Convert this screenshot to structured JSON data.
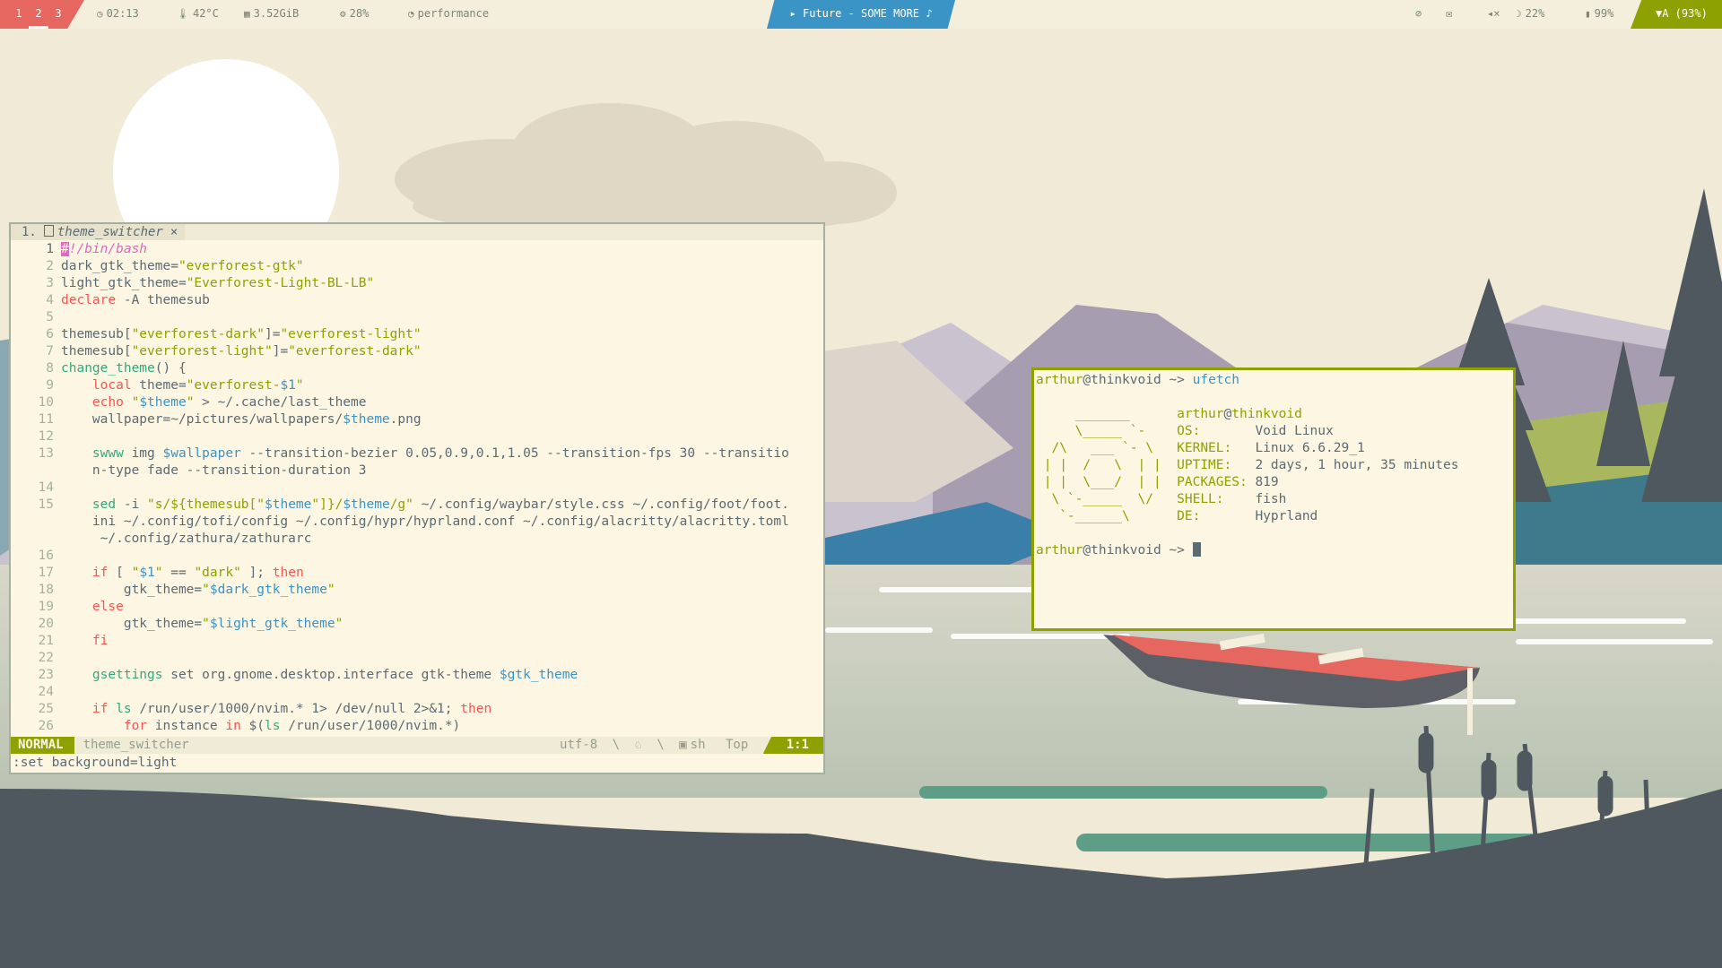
{
  "colors": {
    "workspace_bg": "#e5675f",
    "media_bg": "#3a94c5",
    "network_bg": "#8da101",
    "terminal_border": "#8da101",
    "nvim_mode_bg": "#8da101"
  },
  "topbar": {
    "workspaces": [
      "1",
      "2",
      "3"
    ],
    "active_workspace": "2",
    "time": "02:13",
    "temperature": "42°C",
    "memory": "3.52GiB",
    "cpu": "28%",
    "power_profile": "performance",
    "media": "▸ Future - SOME MORE ♪",
    "brightness": "22%",
    "battery": "99%",
    "network": "A (93%)",
    "icons": {
      "clock": "clock-icon",
      "temperature": "thermometer-icon",
      "memory": "memory-icon",
      "cpu": "cpu-icon",
      "power": "power-profile-icon",
      "idle": "idle-inhibitor-icon",
      "notifications": "notification-icon",
      "volume": "mute-icon",
      "brightness": "brightness-icon",
      "battery": "battery-icon",
      "wifi": "wifi-icon"
    }
  },
  "nvim": {
    "tab_index": "1.",
    "tab_name": "theme_switcher",
    "tab_close": "×",
    "lines": [
      {
        "n": "1",
        "text": "#!/bin/bash"
      },
      {
        "n": "2",
        "text": "dark_gtk_theme=\"everforest-gtk\""
      },
      {
        "n": "3",
        "text": "light_gtk_theme=\"Everforest-Light-BL-LB\""
      },
      {
        "n": "4",
        "text": "declare -A themesub"
      },
      {
        "n": "5",
        "text": ""
      },
      {
        "n": "6",
        "text": "themesub[\"everforest-dark\"]=\"everforest-light\""
      },
      {
        "n": "7",
        "text": "themesub[\"everforest-light\"]=\"everforest-dark\""
      },
      {
        "n": "8",
        "text": "change_theme() {"
      },
      {
        "n": "9",
        "text": "    local theme=\"everforest-$1\""
      },
      {
        "n": "10",
        "text": "    echo \"$theme\" > ~/.cache/last_theme"
      },
      {
        "n": "11",
        "text": "    wallpaper=~/pictures/wallpapers/$theme.png"
      },
      {
        "n": "12",
        "text": ""
      },
      {
        "n": "13",
        "text": "    swww img $wallpaper --transition-bezier 0.05,0.9,0.1,1.05 --transition-fps 30 --transitio"
      },
      {
        "n": "",
        "text": "    n-type fade --transition-duration 3"
      },
      {
        "n": "14",
        "text": ""
      },
      {
        "n": "15",
        "text": "    sed -i \"s/${themesub[\"$theme\"]}/$theme/g\" ~/.config/waybar/style.css ~/.config/foot/foot."
      },
      {
        "n": "",
        "text": "    ini ~/.config/tofi/config ~/.config/hypr/hyprland.conf ~/.config/alacritty/alacritty.toml"
      },
      {
        "n": "",
        "text": "     ~/.config/zathura/zathurarc"
      },
      {
        "n": "16",
        "text": ""
      },
      {
        "n": "17",
        "text": "    if [ \"$1\" == \"dark\" ]; then"
      },
      {
        "n": "18",
        "text": "        gtk_theme=\"$dark_gtk_theme\""
      },
      {
        "n": "19",
        "text": "    else"
      },
      {
        "n": "20",
        "text": "        gtk_theme=\"$light_gtk_theme\""
      },
      {
        "n": "21",
        "text": "    fi"
      },
      {
        "n": "22",
        "text": ""
      },
      {
        "n": "23",
        "text": "    gsettings set org.gnome.desktop.interface gtk-theme $gtk_theme"
      },
      {
        "n": "24",
        "text": ""
      },
      {
        "n": "25",
        "text": "    if ls /run/user/1000/nvim.* 1> /dev/null 2>&1; then"
      },
      {
        "n": "26",
        "text": "        for instance in $(ls /run/user/1000/nvim.*)"
      }
    ],
    "status": {
      "mode": "NORMAL",
      "file": "theme_switcher",
      "encoding": "utf-8",
      "os_icon": "linux-icon",
      "filetype": "sh",
      "position": "Top",
      "cursor": "1:1"
    },
    "command_line": ":set background=light"
  },
  "terminal": {
    "prompt_user": "arthur",
    "prompt_host": "thinkvoid",
    "prompt_suffix": " ~> ",
    "command": "ufetch",
    "ascii": [
      "     _______",
      "     \\_____ `-",
      "  /\\   ___ `- \\",
      " | |  /   \\  | |",
      " | |  \\___/  | |",
      "  \\ `-_____  \\/",
      "   `-______\\"
    ],
    "info_user": "arthur",
    "info_host": "thinkvoid",
    "info": [
      {
        "label": "OS:",
        "value": "Void Linux"
      },
      {
        "label": "KERNEL:",
        "value": "Linux 6.6.29_1"
      },
      {
        "label": "UPTIME:",
        "value": "2 days, 1 hour, 35 minutes"
      },
      {
        "label": "PACKAGES:",
        "value": "819"
      },
      {
        "label": "SHELL:",
        "value": "fish"
      },
      {
        "label": "DE:",
        "value": "Hyprland"
      }
    ]
  }
}
